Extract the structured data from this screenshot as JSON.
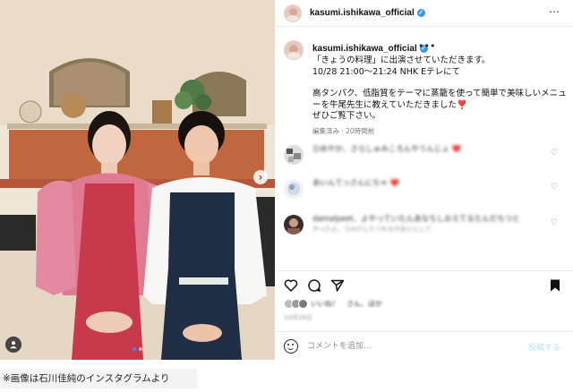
{
  "header": {
    "username": "kasumi.ishikawa_official",
    "verified_icon": "verified-badge-icon",
    "more_icon": "more-options-icon",
    "more_label": "⋯"
  },
  "post": {
    "username": "kasumi.ishikawa_official",
    "more_label": "•••",
    "caption_lines": [
      "「きょうの料理」に出演させていただきます。",
      "10/28 21:00〜21:24 NHK Eテレにて",
      "高タンパク、低脂質をテーマに蒸籠を使って簡単で美味しいメニュ",
      "ーを牛尾先生に教えていただきました❣️",
      "ぜひご覧下さい。"
    ],
    "edited": "編集済み · 20時間前"
  },
  "comments": [
    {
      "text": "ひめやか、さらしゅみころんやうんじょ ❤️",
      "sub": "　",
      "heart_icon": "heart-outline-icon",
      "heart": "♡"
    },
    {
      "text": "あいんてっさんにちゃ ❤️",
      "sub": "　",
      "heart_icon": "heart-outline-icon",
      "heart": "♡"
    },
    {
      "text": "damalpeet、よやっていたんあなちしおえてるたんだちつと",
      "sub": "やったよ、うみだしたつもるやおとにして",
      "heart_icon": "heart-outline-icon",
      "heart": "♡"
    }
  ],
  "actions": {
    "like_icon": "heart-outline-icon",
    "comment_icon": "comment-bubble-icon",
    "share_icon": "paper-plane-icon",
    "save_icon": "bookmark-icon"
  },
  "likes": {
    "text": "いいね！　さん、ほか",
    "date": "10月26日"
  },
  "composer": {
    "emoji_icon": "emoji-smile-icon",
    "placeholder": "コメントを追加...",
    "post_label": "投稿する"
  },
  "photo": {
    "user_tag_icon": "user-tag-icon",
    "next_icon": "chevron-right-icon",
    "next_label": "›"
  },
  "credit": "※画像は石川佳純のインスタグラムより",
  "colors": {
    "verified": "#3897f0",
    "post_button": "#b2dffc",
    "apron_red": "#c83a4b",
    "apron_navy": "#1f2e45"
  }
}
